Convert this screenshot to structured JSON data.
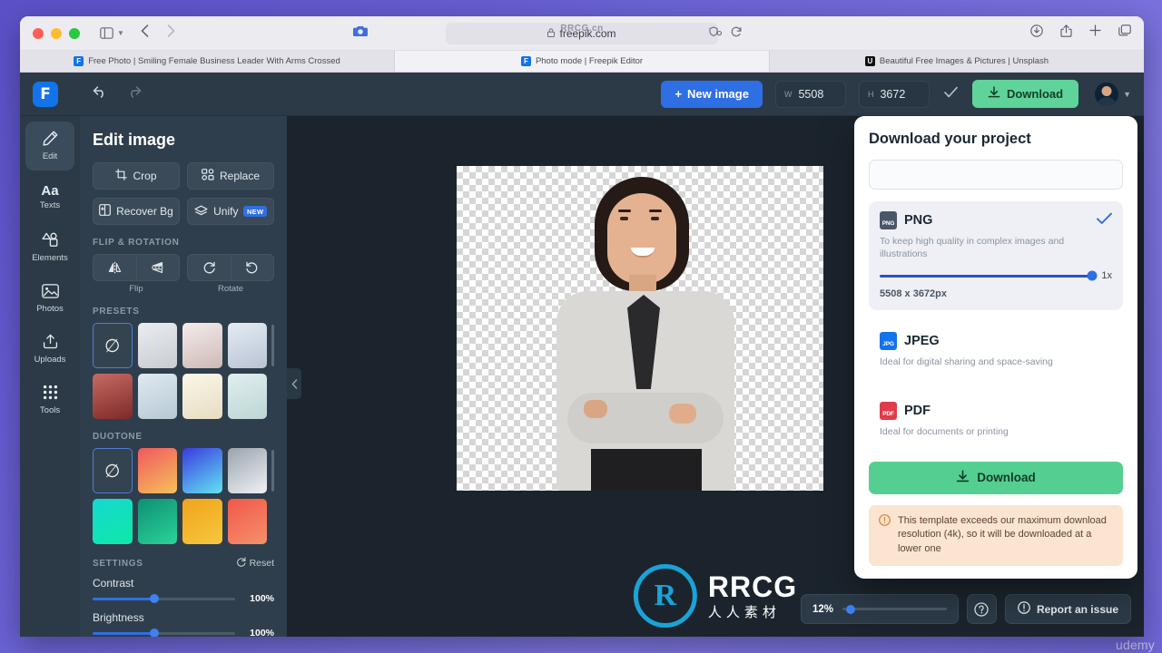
{
  "browser": {
    "url": "freepik.com",
    "lock_icon": "lock-icon",
    "camera_icon": "camera-icon",
    "tabs": [
      {
        "title": "Free Photo | Smiling Female Business Leader With Arms Crossed",
        "favicon": "freepik-favicon",
        "active": false
      },
      {
        "title": "Photo mode | Freepik Editor",
        "favicon": "freepik-favicon",
        "active": true
      },
      {
        "title": "Beautiful Free Images & Pictures | Unsplash",
        "favicon": "unsplash-favicon",
        "active": false
      }
    ],
    "icons": {
      "sidebar": "sidebar-toggle-icon",
      "back": "back-arrow-icon",
      "forward": "forward-arrow-icon",
      "shield": "shield-icon",
      "reload": "reload-icon",
      "downloads": "downloads-icon",
      "share": "share-icon",
      "new_tab": "plus-icon",
      "tab_overview": "tab-overview-icon"
    }
  },
  "toolbar": {
    "logo_letter": "F",
    "undo_label": "undo-icon",
    "redo_label": "redo-icon",
    "new_image_label": "New image",
    "width_label": "W",
    "width_value": "5508",
    "height_label": "H",
    "height_value": "3672",
    "confirm_icon": "check-icon",
    "download_label": "Download",
    "accent_blue": "#2f6fe4",
    "accent_green": "#5fd39a"
  },
  "rail": {
    "items": [
      {
        "label": "Edit",
        "icon": "pencil-icon",
        "active": true
      },
      {
        "label": "Texts",
        "icon": "text-aa-icon",
        "active": false
      },
      {
        "label": "Elements",
        "icon": "shapes-icon",
        "active": false
      },
      {
        "label": "Photos",
        "icon": "photo-icon",
        "active": false
      },
      {
        "label": "Uploads",
        "icon": "upload-icon",
        "active": false
      },
      {
        "label": "Tools",
        "icon": "grid-dots-icon",
        "active": false
      }
    ]
  },
  "panel": {
    "title": "Edit image",
    "tools": [
      {
        "label": "Crop",
        "icon": "crop-icon"
      },
      {
        "label": "Replace",
        "icon": "replace-icon"
      },
      {
        "label": "Recover Bg",
        "icon": "recover-bg-icon"
      },
      {
        "label": "Unify",
        "icon": "unify-icon",
        "badge": "NEW"
      }
    ],
    "flip_section_label": "FLIP & ROTATION",
    "flip_caption": "Flip",
    "rotate_caption": "Rotate",
    "presets_label": "PRESETS",
    "duotone_label": "DUOTONE",
    "settings_label": "SETTINGS",
    "reset_label": "Reset",
    "sliders": [
      {
        "label": "Contrast",
        "value": "100%",
        "pct": 43
      },
      {
        "label": "Brightness",
        "value": "100%",
        "pct": 43
      }
    ]
  },
  "canvas": {
    "collapse_icon": "chevron-left-icon",
    "zoom_value": "12%",
    "help_icon": "question-mark-icon",
    "report_label": "Report an issue",
    "report_icon": "alert-circle-icon"
  },
  "download_popover": {
    "title": "Download your project",
    "filename_value": "",
    "filename_placeholder": "",
    "formats": [
      {
        "name": "PNG",
        "icon": "png-file-icon",
        "description": "To keep high quality in complex images and illustrations",
        "selected": true,
        "quality_label": "1x",
        "size_label": "5508 x 3672px"
      },
      {
        "name": "JPEG",
        "icon": "jpg-file-icon",
        "description": "Ideal for digital sharing and space-saving",
        "selected": false
      },
      {
        "name": "PDF",
        "icon": "pdf-file-icon",
        "description": "Ideal for documents or printing",
        "selected": false
      }
    ],
    "download_label": "Download",
    "notice": "This template exceeds our maximum download resolution (4k), so it will be downloaded at a lower one"
  },
  "watermarks": {
    "top": "RRCG.cn",
    "brand_main": "RRCG",
    "brand_sub": "人人素材",
    "brand_glyph": "R",
    "corner": "udemy",
    "big": [
      "RRCG",
      "人人素材",
      "RRCG",
      "人人素材"
    ]
  }
}
